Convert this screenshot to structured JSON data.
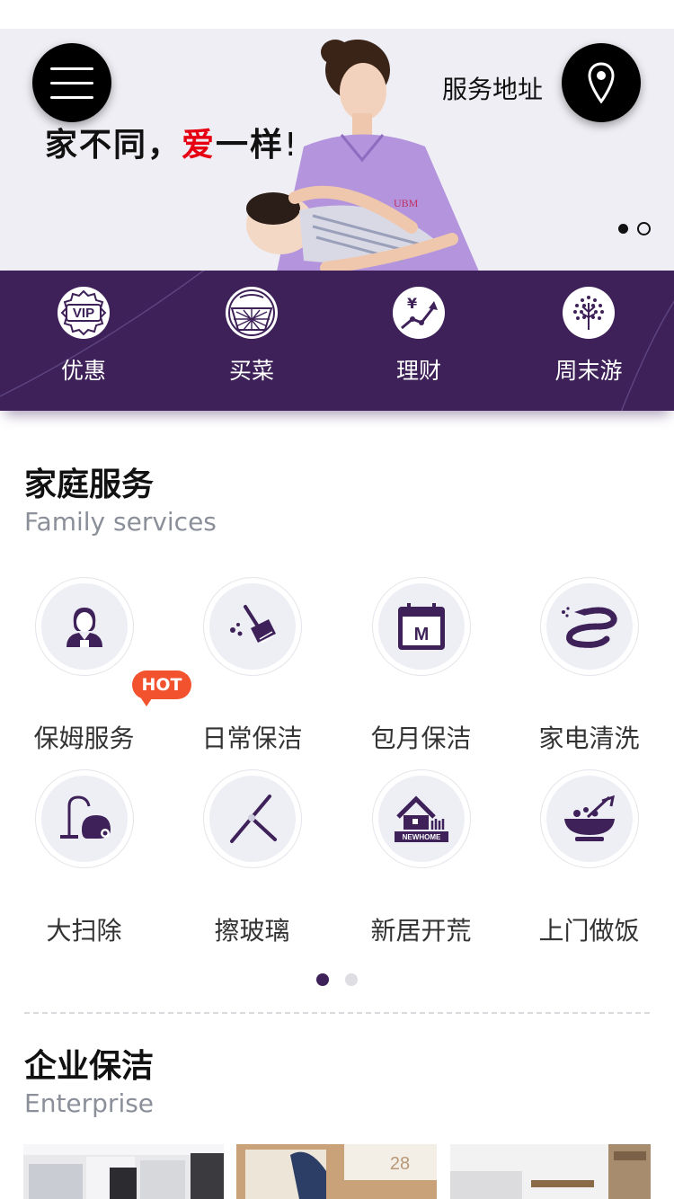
{
  "banner": {
    "slogan_part1": "家不同，",
    "slogan_red": "爱",
    "slogan_part2": "一样",
    "slogan_excl": "!",
    "address_label": "服务地址",
    "slide_count": 2,
    "active_slide": 1
  },
  "quickbar": {
    "items": [
      {
        "label": "优惠",
        "icon": "vip-badge-icon"
      },
      {
        "label": "买菜",
        "icon": "basket-icon"
      },
      {
        "label": "理财",
        "icon": "finance-chart-icon"
      },
      {
        "label": "周末游",
        "icon": "tree-icon"
      }
    ]
  },
  "family": {
    "title": "家庭服务",
    "subtitle": "Family services",
    "hot_badge": "HOT",
    "items": [
      {
        "label": "保姆服务",
        "icon": "nanny-icon"
      },
      {
        "label": "日常保洁",
        "icon": "broom-icon"
      },
      {
        "label": "包月保洁",
        "icon": "calendar-icon"
      },
      {
        "label": "家电清洗",
        "icon": "hose-icon"
      },
      {
        "label": "大扫除",
        "icon": "vacuum-icon"
      },
      {
        "label": "擦玻璃",
        "icon": "squeegee-icon"
      },
      {
        "label": "新居开荒",
        "icon": "new-home-icon"
      },
      {
        "label": "上门做饭",
        "icon": "cooking-bowl-icon"
      }
    ],
    "new_home_text": "NEWHOME",
    "calendar_letter": "M",
    "page_count": 2,
    "active_page": 1
  },
  "enterprise": {
    "title": "企业保洁",
    "subtitle": "Enterprise",
    "calendar_number": "28"
  },
  "colors": {
    "brand_purple": "#3d2158",
    "hot_orange": "#f2522e",
    "slogan_red": "#e60012"
  }
}
